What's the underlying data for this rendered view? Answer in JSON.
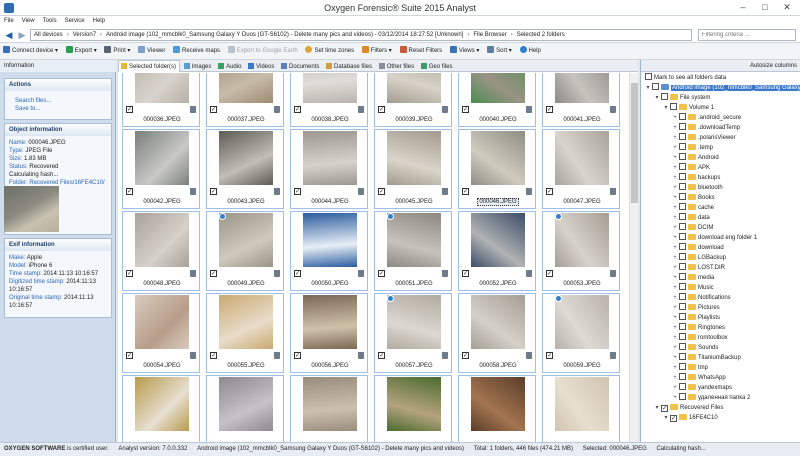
{
  "window": {
    "title": "Oxygen Forensic® Suite 2015 Analyst"
  },
  "menu": [
    "File",
    "View",
    "Tools",
    "Service",
    "Help"
  ],
  "breadcrumb": [
    "All devices",
    "Version7",
    "Android image (102_mmcblk0_Samsung Galaxy Y Duos (GT-S6102) - Delete many pics and videos) - 03/12/2014 18:27:52 [Unknown]",
    "File Browser",
    "Selected 2 folders"
  ],
  "filter": {
    "placeholder": "Filtering criteria ..."
  },
  "toolbar": {
    "connect": "Connect device",
    "export": "Export",
    "print": "Print",
    "viewer": "Viewer",
    "receive_maps": "Receive maps",
    "export_ge": "Export to Google Earth",
    "set_time": "Set time zones",
    "filters": "Filters",
    "reset_filters": "Reset Filters",
    "views": "Views",
    "sort": "Sort",
    "help": "Help"
  },
  "info": {
    "header": "Information",
    "actions_title": "Actions",
    "search_files": "Search files...",
    "save_to": "Save to...",
    "object_title": "Object information",
    "object": [
      [
        "Name:",
        "000046.JPEG"
      ],
      [
        "Type:",
        "JPEG File"
      ],
      [
        "Size:",
        "1.83 MB"
      ],
      [
        "Status:",
        "Recovered"
      ],
      [
        "",
        "Calculating hash..."
      ],
      [
        "Folder:",
        "Recovered Files/16FE4C10/"
      ]
    ],
    "exif_title": "Exif information",
    "exif": [
      [
        "Make:",
        "Apple"
      ],
      [
        "Model:",
        "iPhone 6"
      ],
      [
        "Time stamp:",
        "2014:11:13 10:16:57"
      ],
      [
        "Digitized time stamp:",
        "2014:11:13"
      ],
      [
        "",
        "10:16:57"
      ],
      [
        "Original time stamp:",
        "2014:11:13"
      ],
      [
        "",
        "10:16:57"
      ]
    ]
  },
  "tabs": [
    "Selected folder(s)",
    "Images",
    "Audio",
    "Videos",
    "Documents",
    "Database files",
    "Other files",
    "Geo files"
  ],
  "tab_icon_colors": [
    "#e8b53b",
    "#5b9bd5",
    "#3aa05f",
    "#3c78c8",
    "#5b7fbf",
    "#d19b3f",
    "#8a8fa0",
    "#3f9a6a"
  ],
  "files": [
    {
      "name": "000036.JPEG",
      "c1": "#b7b0a5",
      "c2": "#d8d3cc",
      "glob": false,
      "sel": false
    },
    {
      "name": "000037.JPEG",
      "c1": "#9d8a72",
      "c2": "#c8bca8",
      "glob": false,
      "sel": false
    },
    {
      "name": "000038.JPEG",
      "c1": "#b9b4ae",
      "c2": "#e0ddd8",
      "glob": false,
      "sel": false
    },
    {
      "name": "000039.JPEG",
      "c1": "#a59d92",
      "c2": "#d8d2c8",
      "glob": false,
      "sel": false
    },
    {
      "name": "000040.JPEG",
      "c1": "#4c8d52",
      "c2": "#9a9385",
      "glob": false,
      "sel": false
    },
    {
      "name": "000041.JPEG",
      "c1": "#8c8a86",
      "c2": "#c7c4be",
      "glob": false,
      "sel": false
    },
    {
      "name": "000042.JPEG",
      "c1": "#7a7f7a",
      "c2": "#c9c9c6",
      "glob": false,
      "sel": false
    },
    {
      "name": "000043.JPEG",
      "c1": "#5e5b55",
      "c2": "#c2beb6",
      "glob": false,
      "sel": false
    },
    {
      "name": "000044.JPEG",
      "c1": "#9c978f",
      "c2": "#d7d3cc",
      "glob": false,
      "sel": false
    },
    {
      "name": "000045.JPEG",
      "c1": "#a29a8d",
      "c2": "#dad4ca",
      "glob": false,
      "sel": false
    },
    {
      "name": "000046.JPEG",
      "c1": "#8f8d84",
      "c2": "#d0cbbf",
      "glob": false,
      "sel": true
    },
    {
      "name": "000047.JPEG",
      "c1": "#a9a49b",
      "c2": "#d9d4cc",
      "glob": false,
      "sel": false
    },
    {
      "name": "000048.JPEG",
      "c1": "#a7a199",
      "c2": "#d6d1c9",
      "glob": false,
      "sel": false
    },
    {
      "name": "000049.JPEG",
      "c1": "#9b9488",
      "c2": "#cfc9be",
      "glob": true,
      "sel": false
    },
    {
      "name": "000050.JPEG",
      "c1": "#2a5c9e",
      "c2": "#e7eef6",
      "glob": false,
      "sel": false
    },
    {
      "name": "000051.JPEG",
      "c1": "#8c8780",
      "c2": "#c7c3bc",
      "glob": true,
      "sel": false
    },
    {
      "name": "000052.JPEG",
      "c1": "#3c4d66",
      "c2": "#b1b3b4",
      "glob": false,
      "sel": false
    },
    {
      "name": "000053.JPEG",
      "c1": "#a49e95",
      "c2": "#d8d3ca",
      "glob": true,
      "sel": false
    },
    {
      "name": "000054.JPEG",
      "c1": "#d8cbbf",
      "c2": "#b79d88",
      "glob": false,
      "sel": false
    },
    {
      "name": "000055.JPEG",
      "c1": "#c9a96f",
      "c2": "#e9dccb",
      "glob": false,
      "sel": false
    },
    {
      "name": "000056.JPEG",
      "c1": "#7a6a55",
      "c2": "#cfc0a8",
      "glob": false,
      "sel": false
    },
    {
      "name": "000057.JPEG",
      "c1": "#b1aa9f",
      "c2": "#dcd8d0",
      "glob": true,
      "sel": false
    },
    {
      "name": "000058.JPEG",
      "c1": "#a59f95",
      "c2": "#d5d0c8",
      "glob": false,
      "sel": false
    },
    {
      "name": "000059.JPEG",
      "c1": "#b8b2a8",
      "c2": "#dedad4",
      "glob": true,
      "sel": false
    },
    {
      "name": "",
      "c1": "#b89a4a",
      "c2": "#e6dfd2",
      "glob": false,
      "sel": false,
      "partial": true
    },
    {
      "name": "",
      "c1": "#8d8a8e",
      "c2": "#c5c2c8",
      "glob": false,
      "sel": false,
      "partial": true
    },
    {
      "name": "",
      "c1": "#9b8d7d",
      "c2": "#cbbfae",
      "glob": false,
      "sel": false,
      "partial": true
    },
    {
      "name": "",
      "c1": "#4b6b2f",
      "c2": "#b5a37e",
      "glob": false,
      "sel": false,
      "partial": true
    },
    {
      "name": "",
      "c1": "#5a3d2a",
      "c2": "#a4754f",
      "glob": false,
      "sel": false,
      "partial": true
    },
    {
      "name": "",
      "c1": "#d0c4b0",
      "c2": "#e8dfcf",
      "glob": false,
      "sel": false,
      "partial": true
    }
  ],
  "tree": {
    "top_label": "Mark to see all folders data",
    "autosize": "Autosize columns",
    "items": [
      {
        "label": "Android image (102_mmcblk0_Samsung Galaxy Y Duos",
        "depth": 0,
        "sel": true
      },
      {
        "label": "File system",
        "depth": 1
      },
      {
        "label": "Volume 1",
        "depth": 2
      },
      {
        "label": ".android_secure",
        "depth": 3
      },
      {
        "label": ".downloadTemp",
        "depth": 3
      },
      {
        "label": ".polarisViewer",
        "depth": 3
      },
      {
        "label": ".temp",
        "depth": 3
      },
      {
        "label": "Android",
        "depth": 3
      },
      {
        "label": "APK",
        "depth": 3
      },
      {
        "label": "backups",
        "depth": 3
      },
      {
        "label": "bluetooth",
        "depth": 3
      },
      {
        "label": "Books",
        "depth": 3
      },
      {
        "label": "cache",
        "depth": 3
      },
      {
        "label": "data",
        "depth": 3
      },
      {
        "label": "DCIM",
        "depth": 3
      },
      {
        "label": "download eng folder 1",
        "depth": 3
      },
      {
        "label": "download",
        "depth": 3
      },
      {
        "label": "LGBackup",
        "depth": 3
      },
      {
        "label": "LOST.DIR",
        "depth": 3
      },
      {
        "label": "media",
        "depth": 3
      },
      {
        "label": "Music",
        "depth": 3
      },
      {
        "label": "Notifications",
        "depth": 3
      },
      {
        "label": "Pictures",
        "depth": 3
      },
      {
        "label": "Playlists",
        "depth": 3
      },
      {
        "label": "Ringtones",
        "depth": 3
      },
      {
        "label": "romtoolbox",
        "depth": 3
      },
      {
        "label": "Sounds",
        "depth": 3
      },
      {
        "label": "TitaniumBackup",
        "depth": 3
      },
      {
        "label": "tmp",
        "depth": 3
      },
      {
        "label": "WhatsApp",
        "depth": 3
      },
      {
        "label": "yandexmaps",
        "depth": 3
      },
      {
        "label": "удаленная папка 2",
        "depth": 3
      },
      {
        "label": "Recovered Files",
        "depth": 1,
        "checked": true
      },
      {
        "label": "16FE4C10",
        "depth": 2,
        "checked": true
      }
    ]
  },
  "status": {
    "brand": "OXYGEN SOFTWARE",
    "certified": "is certified user.",
    "version": "Analyst version: 7.0.0.332",
    "image": "Android image (102_mmcblk0_Samsung Galaxy Y Duos (GT-S6102) - Delete many pics and videos)",
    "total": "Total: 1 folders, 446 files (474.21 MB)",
    "selected": "Selected: 000046.JPEG",
    "hash": "Calculating hash..."
  }
}
